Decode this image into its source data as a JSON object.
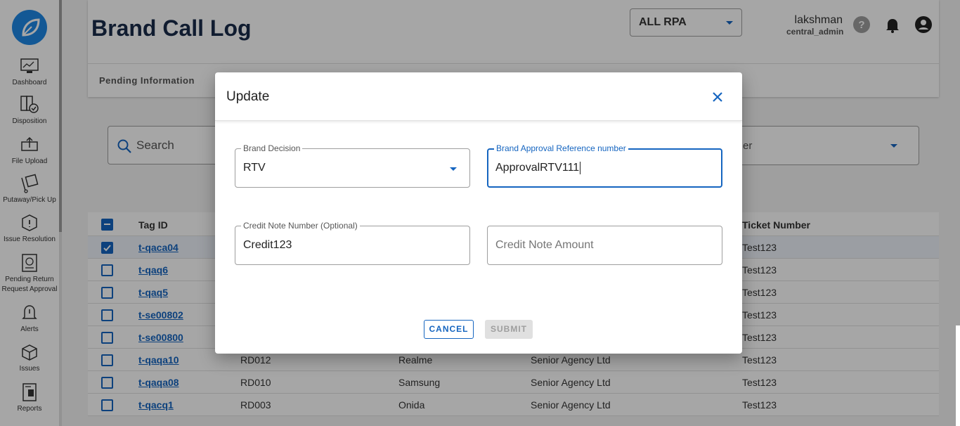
{
  "sidebar": {
    "items": [
      {
        "label": "Dashboard",
        "icon": "dashboard-icon"
      },
      {
        "label": "Disposition",
        "icon": "disposition-icon"
      },
      {
        "label": "File Upload",
        "icon": "file-upload-icon"
      },
      {
        "label": "Putaway/Pick Up",
        "icon": "putaway-icon"
      },
      {
        "label": "Issue Resolution",
        "icon": "issue-resolution-icon"
      },
      {
        "label": "Pending Return Request Approval",
        "icon": "pending-return-icon"
      },
      {
        "label": "Alerts",
        "icon": "alerts-icon"
      },
      {
        "label": "Issues",
        "icon": "issues-icon"
      },
      {
        "label": "Reports",
        "icon": "reports-icon"
      }
    ]
  },
  "header": {
    "title": "Brand Call Log",
    "rpa_select": "ALL RPA",
    "user_name": "lakshman",
    "user_role": "central_admin"
  },
  "tabs": [
    {
      "label": "Pending Information"
    }
  ],
  "filters": {
    "search_placeholder": "Search",
    "filter_partial": "er"
  },
  "table": {
    "headers": {
      "tag_id": "Tag ID",
      "ticket": "Ticket Number"
    },
    "rows": [
      {
        "tag": "t-qaca04",
        "ret": "",
        "brand": "",
        "agency": "",
        "ticket": "Test123",
        "checked": true
      },
      {
        "tag": "t-qaq6",
        "ret": "",
        "brand": "",
        "agency": "",
        "ticket": "Test123",
        "checked": false
      },
      {
        "tag": "t-qaq5",
        "ret": "",
        "brand": "",
        "agency": "",
        "ticket": "Test123",
        "checked": false
      },
      {
        "tag": "t-se00802",
        "ret": "",
        "brand": "",
        "agency": "",
        "ticket": "Test123",
        "checked": false
      },
      {
        "tag": "t-se00800",
        "ret": "",
        "brand": "",
        "agency": "",
        "ticket": "Test123",
        "checked": false
      },
      {
        "tag": "t-qaqa10",
        "ret": "RD012",
        "brand": "Realme",
        "agency": "Senior Agency Ltd",
        "ticket": "Test123",
        "checked": false
      },
      {
        "tag": "t-qaqa08",
        "ret": "RD010",
        "brand": "Samsung",
        "agency": "Senior Agency Ltd",
        "ticket": "Test123",
        "checked": false
      },
      {
        "tag": "t-qacq1",
        "ret": "RD003",
        "brand": "Onida",
        "agency": "Senior Agency Ltd",
        "ticket": "Test123",
        "checked": false
      }
    ]
  },
  "dialog": {
    "title": "Update",
    "brand_decision_label": "Brand Decision",
    "brand_decision_value": "RTV",
    "ref_label": "Brand Approval Reference number",
    "ref_value": "ApprovalRTV111",
    "credit_note_label": "Credit Note Number (Optional)",
    "credit_note_value": "Credit123",
    "credit_amount_placeholder": "Credit Note Amount",
    "cancel_label": "CANCEL",
    "submit_label": "SUBMIT"
  },
  "colors": {
    "accent": "#1565c0",
    "title": "#1a2b4a"
  }
}
